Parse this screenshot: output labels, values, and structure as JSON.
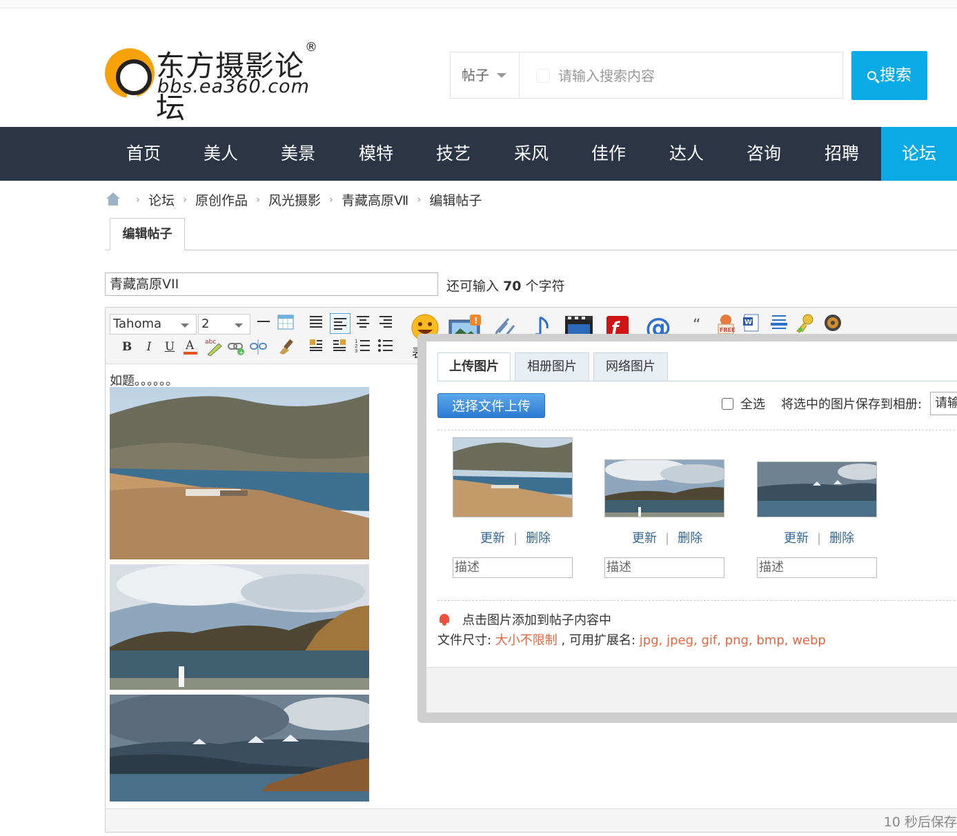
{
  "header": {
    "logo_cn": "东方摄影论坛",
    "logo_reg": "®",
    "logo_en": "bbs.ea360.com",
    "search_type": "帖子",
    "search_placeholder": "请输入搜索内容",
    "search_button": "搜索"
  },
  "nav": {
    "items": [
      "首页",
      "美人",
      "美景",
      "模特",
      "技艺",
      "采风",
      "佳作",
      "达人",
      "咨询",
      "招聘",
      "论坛"
    ],
    "active": "论坛"
  },
  "breadcrumb": [
    "论坛",
    "原创作品",
    "风光摄影",
    "青藏高原Ⅶ",
    "编辑帖子"
  ],
  "tab": "编辑帖子",
  "title": {
    "value": "青藏高原VII",
    "remain_prefix": "还可输入",
    "remain_count": "70",
    "remain_suffix": "个字符"
  },
  "editor": {
    "font": "Tahoma",
    "size": "2",
    "content_text": "如题。。。。。。",
    "autosave": "10 秒后保存",
    "emoji_label": "表"
  },
  "dialog": {
    "tabs": [
      "上传图片",
      "相册图片",
      "网络图片"
    ],
    "active_tab": "上传图片",
    "upload_button": "选择文件上传",
    "select_all": "全选",
    "save_to_album": "将选中的图片保存到相册:",
    "album_select": "请输",
    "thumbs": [
      {
        "update": "更新",
        "delete": "删除",
        "desc_placeholder": "描述"
      },
      {
        "update": "更新",
        "delete": "删除",
        "desc_placeholder": "描述"
      },
      {
        "update": "更新",
        "delete": "删除",
        "desc_placeholder": "描述"
      }
    ],
    "notice": "点击图片添加到帖子内容中",
    "file_size_label": "文件尺寸:",
    "file_size_value": "大小不限制",
    "ext_label": ", 可用扩展名:",
    "ext_value": "jpg, jpeg, gif, png, bmp, webp"
  },
  "colors": {
    "accent": "#0aaae6",
    "nav_bg": "#2b3545",
    "link": "#336699",
    "warn": "#e8643c"
  }
}
